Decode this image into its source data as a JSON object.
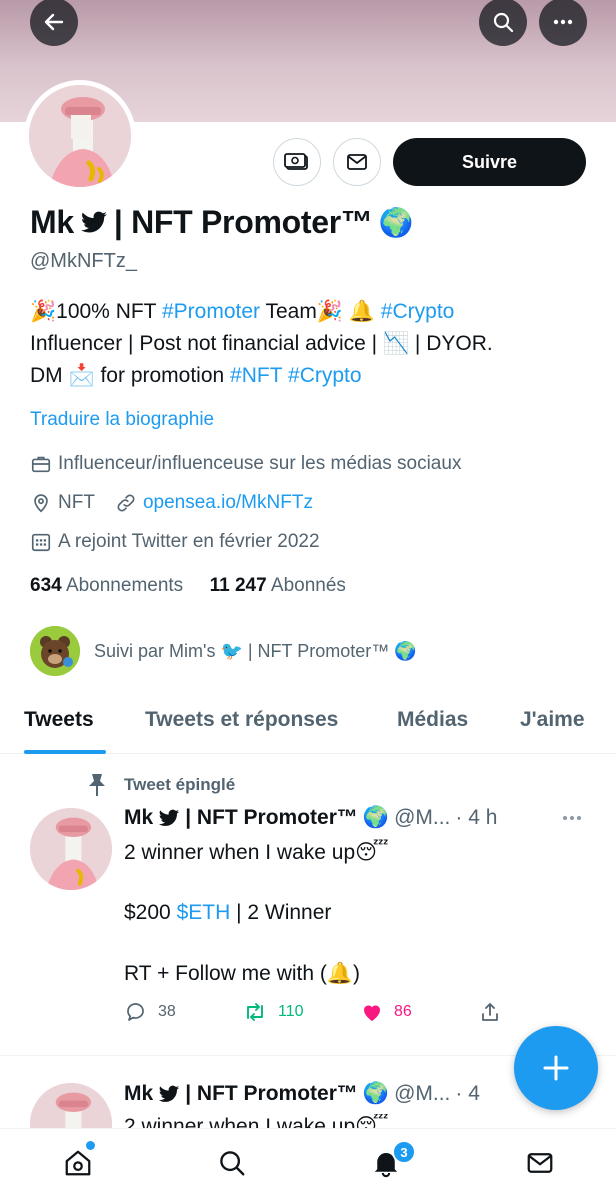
{
  "profile": {
    "name": "Mk",
    "name_suffix": "| NFT Promoter™",
    "handle": "@MkNFTz_",
    "follow_label": "Suivre",
    "bio_line1_pre": "🎉100% NFT ",
    "bio_tag1": "#Promoter",
    "bio_line1_mid": " Team🎉 🔔 ",
    "bio_tag2": "#Crypto",
    "bio_line2": "Influencer | Post not financial advice | 📉 | DYOR.",
    "bio_line3_pre": "DM 📩 for promotion ",
    "bio_tag3": "#NFT",
    "bio_tag4": "#Crypto",
    "translate_label": "Traduire la biographie",
    "category": "Influenceur/influenceuse sur les médias sociaux",
    "location": "NFT",
    "website": "opensea.io/MkNFTz",
    "joined": "A rejoint Twitter en février 2022",
    "following_count": "634",
    "following_label": "Abonnements",
    "followers_count": "11 247",
    "followers_label": "Abonnés",
    "followed_by": "Suivi par Mim's 🐦 | NFT Promoter™ 🌍"
  },
  "tabs": [
    {
      "label": "Tweets"
    },
    {
      "label": "Tweets et réponses"
    },
    {
      "label": "Médias"
    },
    {
      "label": "J'aime"
    }
  ],
  "pinned_label": "Tweet épinglé",
  "tweet": {
    "name": "Mk",
    "name_suffix": "| NFT Promoter™",
    "handle": "@M...",
    "time": "· 4 h",
    "line1": "2 winner when I wake up😴",
    "line2_pre": "$200 ",
    "line2_tag": "$ETH",
    "line2_post": " | 2 Winner",
    "line3": "RT + Follow me with (🔔)",
    "replies": "38",
    "retweets": "110",
    "likes": "86"
  },
  "tweet2": {
    "name": "Mk",
    "name_suffix": "| NFT Promoter™",
    "handle": "@M...",
    "time": "· 4",
    "line1": "2 winner when I wake up😴"
  },
  "notifications_badge": "3",
  "colors": {
    "accent": "#1d9bf0",
    "text": "#0f1419",
    "muted": "#536471",
    "like": "#f91880",
    "retweet": "#00ba7c"
  }
}
